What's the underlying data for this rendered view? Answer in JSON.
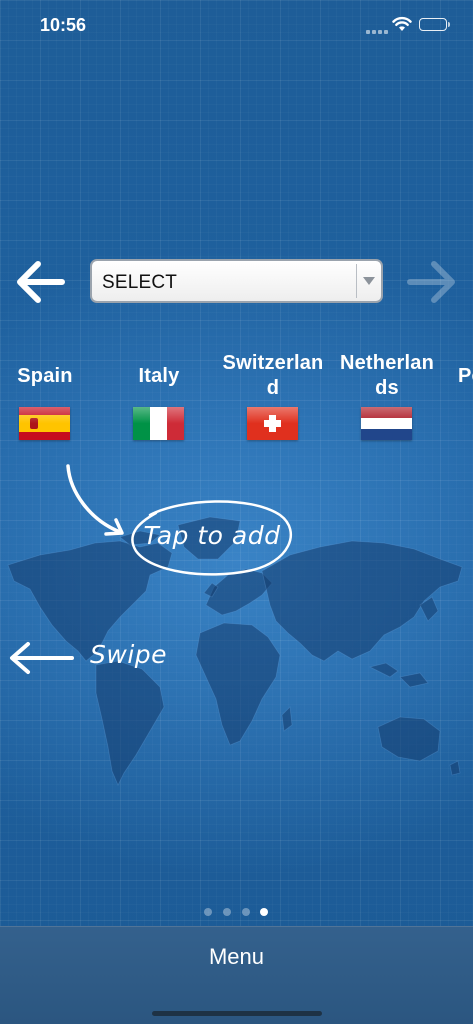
{
  "status_bar": {
    "time": "10:56"
  },
  "selector": {
    "selected": "SELECT"
  },
  "countries": [
    {
      "name": "Spain",
      "flag": "spain-flag-icon"
    },
    {
      "name": "Italy",
      "flag": "italy-flag-icon"
    },
    {
      "name": "Switzerlan\nd",
      "flag": "switzerland-flag-icon"
    },
    {
      "name": "Netherlan\nds",
      "flag": "netherlands-flag-icon"
    },
    {
      "name": "Po",
      "flag": ""
    }
  ],
  "hints": {
    "tap": "Tap to add",
    "swipe": "Swipe"
  },
  "pager": {
    "count": 4,
    "active_index": 3
  },
  "bottom_bar": {
    "menu_label": "Menu"
  },
  "colors": {
    "background": "#1f5f9a",
    "bottom_bar": "#2f5b86",
    "select_bg": "#ffffff"
  }
}
